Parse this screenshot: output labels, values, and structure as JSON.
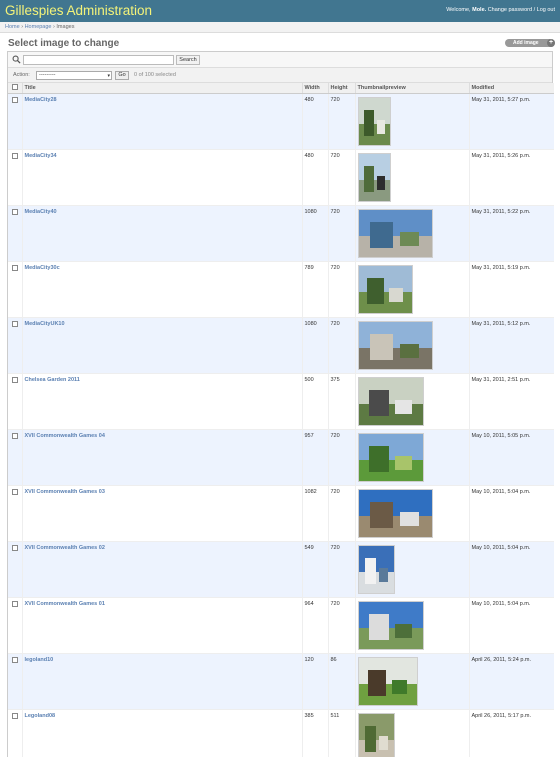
{
  "header": {
    "brand": "Gillespies Administration",
    "welcome": "Welcome,",
    "user": "Mole.",
    "change_password": "Change password",
    "separator": "/",
    "logout": "Log out"
  },
  "breadcrumbs": {
    "home": "Home",
    "sep": "›",
    "homepage": "Homepage",
    "current": "Images"
  },
  "page": {
    "title": "Select image to change",
    "add_button": "Add image",
    "add_icon": "+"
  },
  "search": {
    "value": "",
    "button": "Search",
    "icon": "search-icon"
  },
  "actions": {
    "label": "Action:",
    "selected_option": "---------",
    "go": "Go",
    "selected_count": "0 of 100 selected"
  },
  "table": {
    "headers": [
      "Title",
      "Width",
      "Height",
      "Thumbnailpreview",
      "Modified"
    ],
    "rows": [
      {
        "title": "MediaCity28",
        "width": "480",
        "height": "720",
        "modified": "May 31, 2011, 5:27 p.m.",
        "thumb": {
          "sky": "#cfd8cf",
          "ground": "#6b8a4c",
          "s1": "#3d5a2a",
          "s2": "#e8e8e0"
        }
      },
      {
        "title": "MediaCity34",
        "width": "480",
        "height": "720",
        "modified": "May 31, 2011, 5:26 p.m.",
        "thumb": {
          "sky": "#b8cfe3",
          "ground": "#8a9a80",
          "s1": "#4f6b3a",
          "s2": "#2d2d2d"
        }
      },
      {
        "title": "MediaCity40",
        "width": "1080",
        "height": "720",
        "modified": "May 31, 2011, 5:22 p.m.",
        "thumb": {
          "sky": "#5f8fc7",
          "ground": "#b7b2a8",
          "s1": "#3f6a8f",
          "s2": "#6d8a55"
        }
      },
      {
        "title": "MediaCity30c",
        "width": "789",
        "height": "720",
        "modified": "May 31, 2011, 5:19 p.m.",
        "thumb": {
          "sky": "#9fbbd6",
          "ground": "#6e8f4a",
          "s1": "#3f5f2e",
          "s2": "#d8d8d0"
        }
      },
      {
        "title": "MediaCityUK10",
        "width": "1080",
        "height": "720",
        "modified": "May 31, 2011, 5:12 p.m.",
        "thumb": {
          "sky": "#8fb2d8",
          "ground": "#7a7466",
          "s1": "#c9c4b8",
          "s2": "#5a7040"
        }
      },
      {
        "title": "Chelsea Garden 2011",
        "width": "500",
        "height": "375",
        "modified": "May 31, 2011, 2:51 p.m.",
        "thumb": {
          "sky": "#c9d1c2",
          "ground": "#5d7a43",
          "s1": "#4b4b4b",
          "s2": "#e5e5e5"
        }
      },
      {
        "title": "XVII Commonwealth Games 04",
        "width": "957",
        "height": "720",
        "modified": "May 10, 2011, 5:05 p.m.",
        "thumb": {
          "sky": "#7ea8d6",
          "ground": "#5c9a3a",
          "s1": "#3e6f2a",
          "s2": "#a8c46a"
        }
      },
      {
        "title": "XVII Commonwealth Games 03",
        "width": "1082",
        "height": "720",
        "modified": "May 10, 2011, 5:04 p.m.",
        "thumb": {
          "sky": "#2f6fc0",
          "ground": "#9a8a70",
          "s1": "#6b5a46",
          "s2": "#e0e0e0"
        }
      },
      {
        "title": "XVII Commonwealth Games 02",
        "width": "549",
        "height": "720",
        "modified": "May 10, 2011, 5:04 p.m.",
        "thumb": {
          "sky": "#3a6fb8",
          "ground": "#d9dde0",
          "s1": "#f2f2f2",
          "s2": "#5a7a9a"
        }
      },
      {
        "title": "XVII Commonwealth Games 01",
        "width": "964",
        "height": "720",
        "modified": "May 10, 2011, 5:04 p.m.",
        "thumb": {
          "sky": "#3f7bc8",
          "ground": "#7a9a5a",
          "s1": "#dcdcdc",
          "s2": "#4d6f3a"
        }
      },
      {
        "title": "legoland10",
        "width": "120",
        "height": "86",
        "modified": "April 26, 2011, 5:24 p.m.",
        "thumb": {
          "sky": "#e2e6e0",
          "ground": "#6fa040",
          "s1": "#4a3a2a",
          "s2": "#3f7a2a"
        }
      },
      {
        "title": "Legoland08",
        "width": "385",
        "height": "511",
        "modified": "April 26, 2011, 5:17 p.m.",
        "thumb": {
          "sky": "#8a9a6a",
          "ground": "#c8c0b0",
          "s1": "#4f6a34",
          "s2": "#e0dcd0"
        }
      }
    ]
  },
  "colors": {
    "header_bg": "#417690",
    "brand": "#f4f379",
    "link": "#5b80b2",
    "row_alt": "#edf3fe"
  }
}
